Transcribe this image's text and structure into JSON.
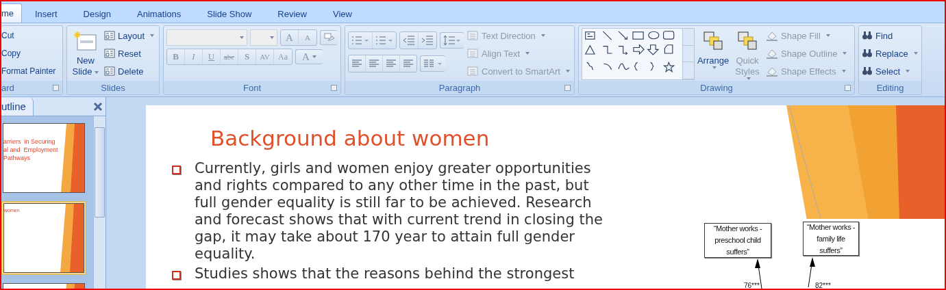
{
  "tabs": [
    {
      "label": "me",
      "selected": true
    },
    {
      "label": "Insert",
      "selected": false
    },
    {
      "label": "Design",
      "selected": false
    },
    {
      "label": "Animations",
      "selected": false
    },
    {
      "label": "Slide Show",
      "selected": false
    },
    {
      "label": "Review",
      "selected": false
    },
    {
      "label": "View",
      "selected": false
    }
  ],
  "clipboard": {
    "label": "ard",
    "commands": [
      {
        "label": "Cut"
      },
      {
        "label": "Copy"
      },
      {
        "label": "Format Painter"
      }
    ]
  },
  "slides_group": {
    "label": "Slides",
    "new_slide": [
      "New",
      "Slide"
    ],
    "commands": [
      {
        "label": "Layout",
        "dropdown": true
      },
      {
        "label": "Reset",
        "dropdown": false
      },
      {
        "label": "Delete",
        "dropdown": false
      }
    ]
  },
  "font": {
    "label": "Font",
    "disabled": true,
    "format_buttons": [
      {
        "label": "B",
        "kind": "bold"
      },
      {
        "label": "I",
        "kind": "italic"
      },
      {
        "label": "U",
        "kind": "underline"
      },
      {
        "label": "abc",
        "kind": "strike"
      },
      {
        "label": "S",
        "kind": "shadow"
      },
      {
        "label": "AV",
        "kind": "spacing"
      },
      {
        "label": "Aa",
        "kind": "case"
      }
    ],
    "grow_buttons": [
      "A",
      "A"
    ],
    "color_button": "A"
  },
  "paragraph": {
    "label": "Paragraph",
    "commands": [
      {
        "label": "Text Direction",
        "disabled": true
      },
      {
        "label": "Align Text",
        "disabled": true
      },
      {
        "label": "Convert to SmartArt",
        "disabled": true
      }
    ]
  },
  "drawing": {
    "label": "Drawing",
    "big_buttons": [
      {
        "lines": [
          "Arrange"
        ],
        "disabled": false
      },
      {
        "lines": [
          "Quick",
          "Styles"
        ],
        "disabled": true
      }
    ],
    "commands": [
      {
        "label": "Shape Fill",
        "disabled": true
      },
      {
        "label": "Shape Outline",
        "disabled": true
      },
      {
        "label": "Shape Effects",
        "disabled": true
      }
    ]
  },
  "editing": {
    "label": "Editing",
    "commands": [
      {
        "label": "Find",
        "dropdown": false
      },
      {
        "label": "Replace",
        "dropdown": true
      },
      {
        "label": "Select",
        "dropdown": true
      }
    ]
  },
  "outline_pane": {
    "tab": "utline",
    "thumbnails": [
      {
        "title_lines": [
          "arriers  in Securing",
          "al and  Employment",
          "Pathways"
        ],
        "selected": false
      },
      {
        "title_lines": [
          "women"
        ],
        "selected": true
      },
      {
        "selected": false
      }
    ]
  },
  "slide": {
    "title": "Background about women",
    "bullets": [
      "Currently, girls and women enjoy greater opportunities and rights compared to any other time in the past, but full gender equality is still far to be achieved. Research and forecast shows that with current trend in closing the gap, it may take about 170 year to attain full gender equality.",
      "Studies shows that the reasons behind the strongest"
    ],
    "diagram": {
      "nodes": [
        "“Mother works - preschool child suffers”",
        "“Mother works - family life suffers”"
      ],
      "edge_labels": [
        "76***",
        "82***"
      ]
    }
  }
}
